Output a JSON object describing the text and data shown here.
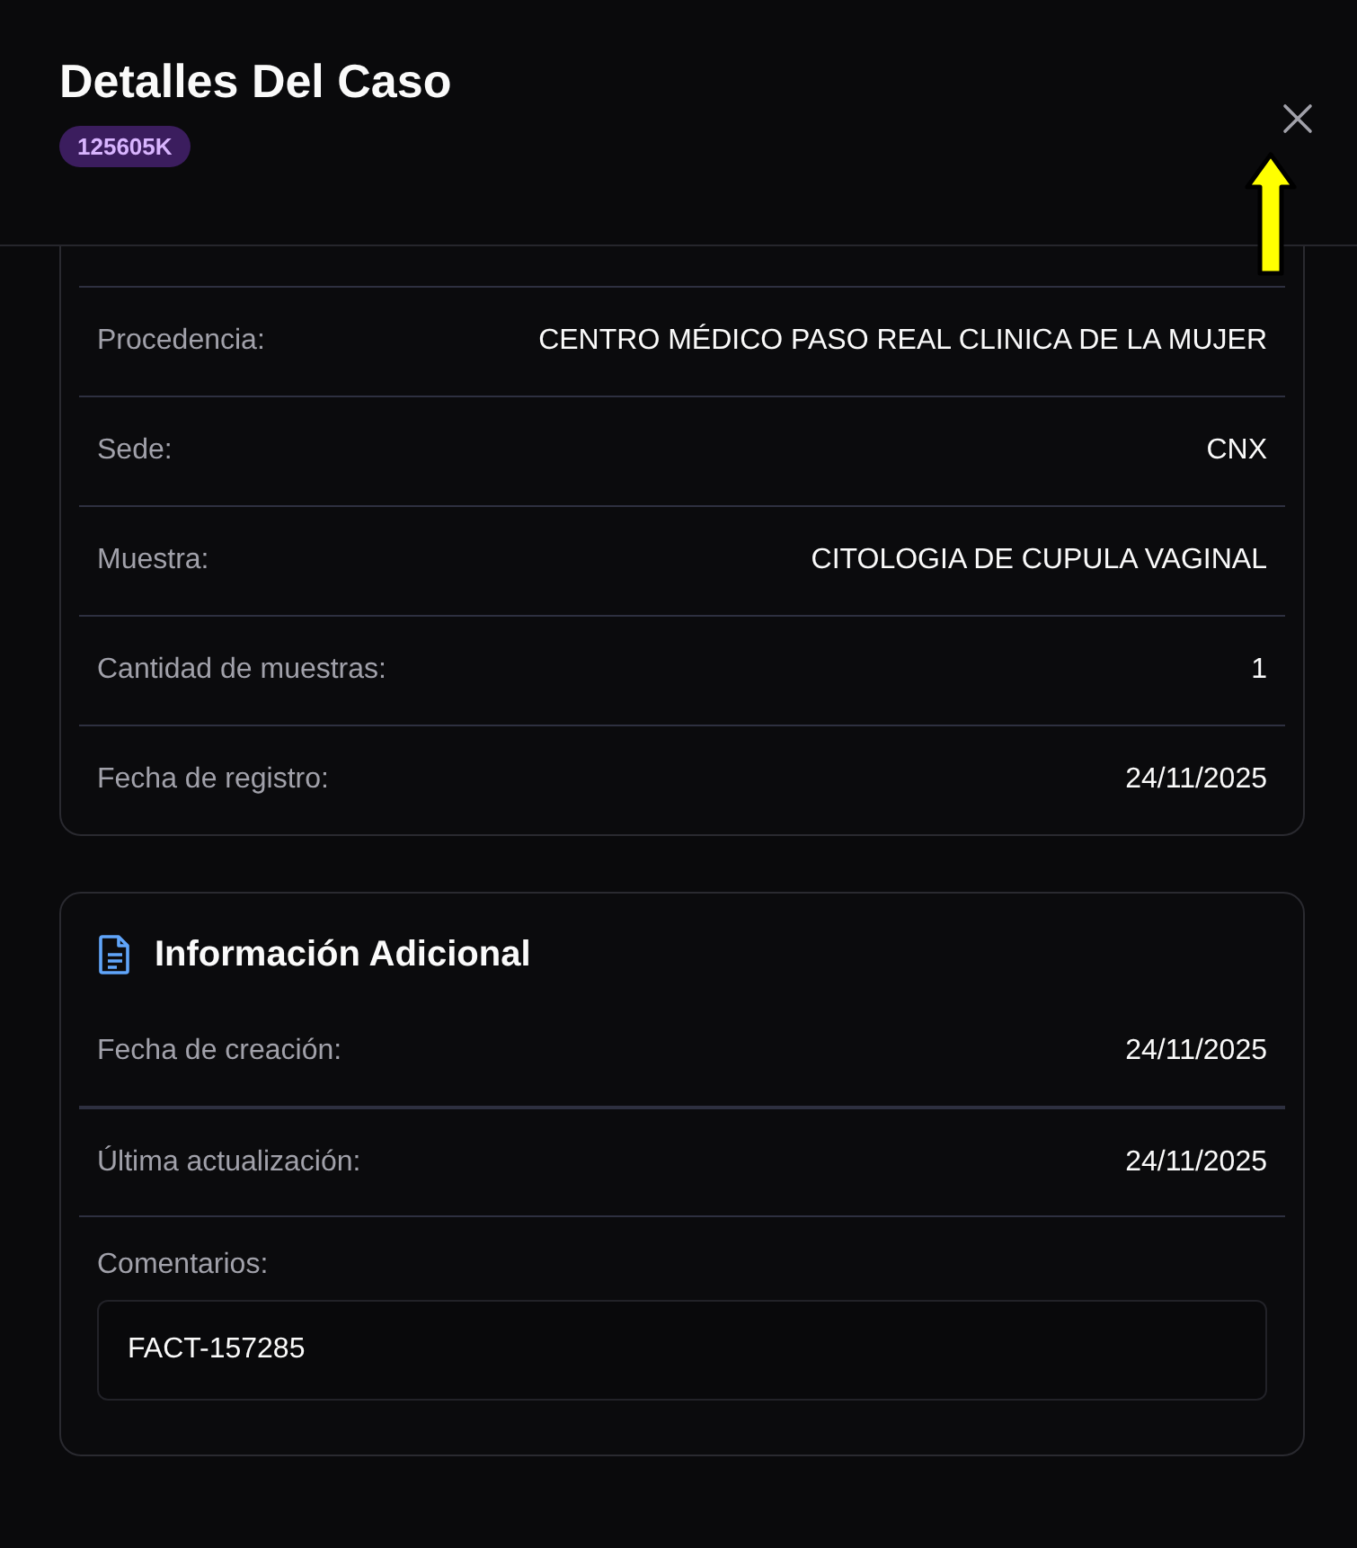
{
  "header": {
    "title": "Detalles Del Caso",
    "case_code": "125605K"
  },
  "details": [
    {
      "label": "Procedencia:",
      "value": "CENTRO MÉDICO PASO REAL CLINICA DE LA MUJER"
    },
    {
      "label": "Sede:",
      "value": "CNX"
    },
    {
      "label": "Muestra:",
      "value": "CITOLOGIA DE CUPULA VAGINAL"
    },
    {
      "label": "Cantidad de muestras:",
      "value": "1"
    },
    {
      "label": "Fecha de registro:",
      "value": "24/11/2025"
    }
  ],
  "additional": {
    "title": "Información Adicional",
    "rows": [
      {
        "label": "Fecha de creación:",
        "value": "24/11/2025"
      },
      {
        "label": "Última actualización:",
        "value": "24/11/2025"
      }
    ],
    "comments_label": "Comentarios:",
    "comments": "FACT-157285"
  }
}
